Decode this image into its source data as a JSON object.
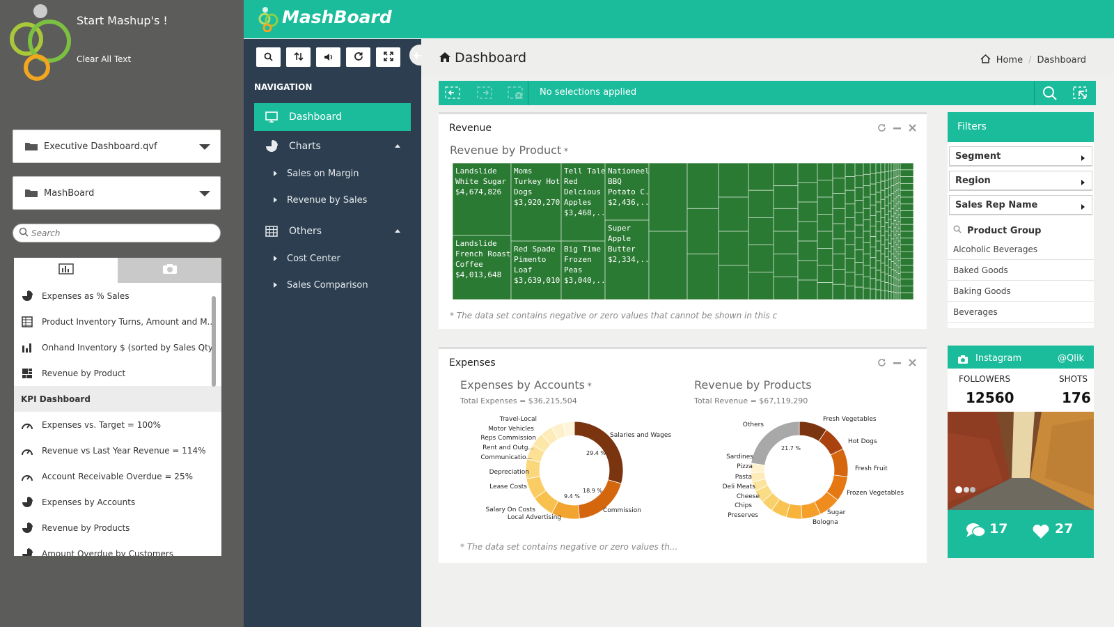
{
  "sidebar": {
    "title": "Start Mashup's !",
    "clear_text": "Clear All Text",
    "dropdown_file": "Executive Dashboard.qvf",
    "dropdown_app": "MashBoard",
    "search_placeholder": "Search",
    "objects": [
      {
        "label": "Expenses as % Sales",
        "icon": "pie-icon"
      },
      {
        "label": "Product Inventory Turns, Amount and M...",
        "icon": "table-icon"
      },
      {
        "label": "Onhand Inventory $ (sorted by Sales Qty)",
        "icon": "bar-icon"
      },
      {
        "label": "Revenue by Product",
        "icon": "treemap-icon"
      },
      {
        "label": "KPI Dashboard",
        "section": true
      },
      {
        "label": "Expenses vs. Target = 100%",
        "icon": "gauge-icon"
      },
      {
        "label": "Revenue vs Last Year Revenue = 114%",
        "icon": "gauge-icon"
      },
      {
        "label": "Account Receivable Overdue = 25%",
        "icon": "gauge-icon"
      },
      {
        "label": "Expenses by Accounts",
        "icon": "pie-icon"
      },
      {
        "label": "Revenue by Products",
        "icon": "pie-icon"
      },
      {
        "label": "Amount Overdue by Customers",
        "icon": "pie-icon"
      }
    ]
  },
  "header": {
    "brand": "MashBoard",
    "page_title": "Dashboard",
    "crumb_home": "Home",
    "crumb_current": "Dashboard"
  },
  "nav": {
    "label": "NAVIGATION",
    "dashboard": "Dashboard",
    "charts": "Charts",
    "sales_on_margin": "Sales on Margin",
    "revenue_by_sales": "Revenue by Sales",
    "others": "Others",
    "cost_center": "Cost Center",
    "sales_comparison": "Sales Comparison"
  },
  "selection": {
    "text": "No selections applied"
  },
  "revenue_panel": {
    "title": "Revenue",
    "chart_title": "Revenue by Product",
    "footnote": "* The data set contains negative or zero values that cannot be shown in this chart",
    "tiles": [
      {
        "name": "Landslide White Sugar",
        "lines": [
          "Landslide",
          "White Sugar",
          "$4,674,826"
        ]
      },
      {
        "name": "Landslide French Roast Coffee",
        "lines": [
          "Landslide",
          "French Roast",
          "Coffee",
          "$4,013,648"
        ]
      },
      {
        "name": "Moms Turkey Hot Dogs",
        "lines": [
          "Moms",
          "Turkey Hot",
          "Dogs",
          "$3,920,270"
        ]
      },
      {
        "name": "Red Spade Pimento Loaf",
        "lines": [
          "Red Spade",
          "Pimento",
          "Loaf",
          "$3,639,010"
        ]
      },
      {
        "name": "Tell Tale Red Delcious Apples",
        "lines": [
          "Tell Tale",
          "Red",
          "Delcious",
          "Apples",
          "$3,468,..."
        ]
      },
      {
        "name": "Big Time Frozen Peas",
        "lines": [
          "Big Time",
          "Frozen",
          "Peas",
          "$3,040,..."
        ]
      },
      {
        "name": "Nationeel BBQ Potato Chips",
        "lines": [
          "Nationeel",
          "BBQ",
          "Potato C...",
          "$2,436,..."
        ]
      },
      {
        "name": "Super Apple Butter",
        "lines": [
          "Super",
          "Apple",
          "Butter",
          "$2,334,..."
        ]
      }
    ]
  },
  "expenses_panel": {
    "title": "Expenses",
    "left_title": "Expenses by Accounts",
    "left_total": "Total Expenses = $36,215,504",
    "right_title": "Revenue by Products",
    "right_total": "Total Revenue = $67,119,290",
    "footnote": "* The data set contains negative or zero values th..."
  },
  "chart_data": [
    {
      "type": "pie",
      "title": "Expenses by Accounts",
      "categories": [
        "Salaries and Wages",
        "Commission",
        "Salary On Costs",
        "Local Advertising",
        "Lease Costs",
        "Depreciation",
        "Communicatio...",
        "Rent and Outg...",
        "Reps Commission",
        "Motor Vehicles",
        "Travel-Local"
      ],
      "values": [
        29.4,
        18.9,
        9.4,
        7.5,
        7,
        6.5,
        5,
        4.5,
        4,
        4,
        3.8
      ],
      "data_labels": [
        "29.4 %",
        "18.9 %",
        "9.4 %"
      ],
      "colors": [
        "#7a3410",
        "#d4660e",
        "#f3a430",
        "#f8c04c",
        "#f9cc64",
        "#fbd77c",
        "#fbe095",
        "#fce6a8",
        "#fdecba",
        "#fdf1cb",
        "#fef5da"
      ]
    },
    {
      "type": "pie",
      "title": "Revenue by Products",
      "categories": [
        "Fresh Vegetables",
        "Hot Dogs",
        "Fresh Fruit",
        "Frozen Vegetables",
        "Sugar",
        "Bologna",
        "Preserves",
        "Chips",
        "Cheese",
        "Deli Meats",
        "Pasta",
        "Pizza",
        "Sardines",
        "Others"
      ],
      "values": [
        9,
        8,
        9,
        8,
        7,
        6,
        5,
        5,
        4,
        4,
        3,
        3,
        3,
        21.7
      ],
      "data_labels": [
        "21.7 %"
      ],
      "colors": [
        "#7a3410",
        "#a9420f",
        "#d4660e",
        "#e57812",
        "#f08c1e",
        "#f59e2a",
        "#f8b33a",
        "#f9c352",
        "#fad06a",
        "#fbdc86",
        "#fce4a0",
        "#fdebb8",
        "#fef2cf",
        "#a8a8a8"
      ]
    },
    {
      "type": "heatmap",
      "title": "Revenue by Product",
      "categories": [
        "Landslide White Sugar",
        "Landslide French Roast Coffee",
        "Moms Turkey Hot Dogs",
        "Red Spade Pimento Loaf",
        "Tell Tale Red Delcious Apples",
        "Big Time Frozen Peas",
        "Nationeel BBQ Potato C...",
        "Super Apple Butter"
      ],
      "values": [
        4674826,
        4013648,
        3920270,
        3639010,
        3468000,
        3040000,
        2436000,
        2334000
      ]
    }
  ],
  "filters": {
    "title": "Filters",
    "items": [
      "Segment",
      "Region",
      "Sales Rep Name"
    ],
    "group_label": "Product Group",
    "options": [
      "Alcoholic Beverages",
      "Baked Goods",
      "Baking Goods",
      "Beverages"
    ]
  },
  "instagram": {
    "title": "Instagram",
    "handle": "@Qlik",
    "followers_label": "FOLLOWERS",
    "followers": "12560",
    "shots_label": "SHOTS",
    "shots": "176",
    "comments": "17",
    "likes": "27"
  },
  "colors": {
    "accent": "#1abc9c",
    "nav": "#2c3e50",
    "treemap": "#2a7a33"
  }
}
